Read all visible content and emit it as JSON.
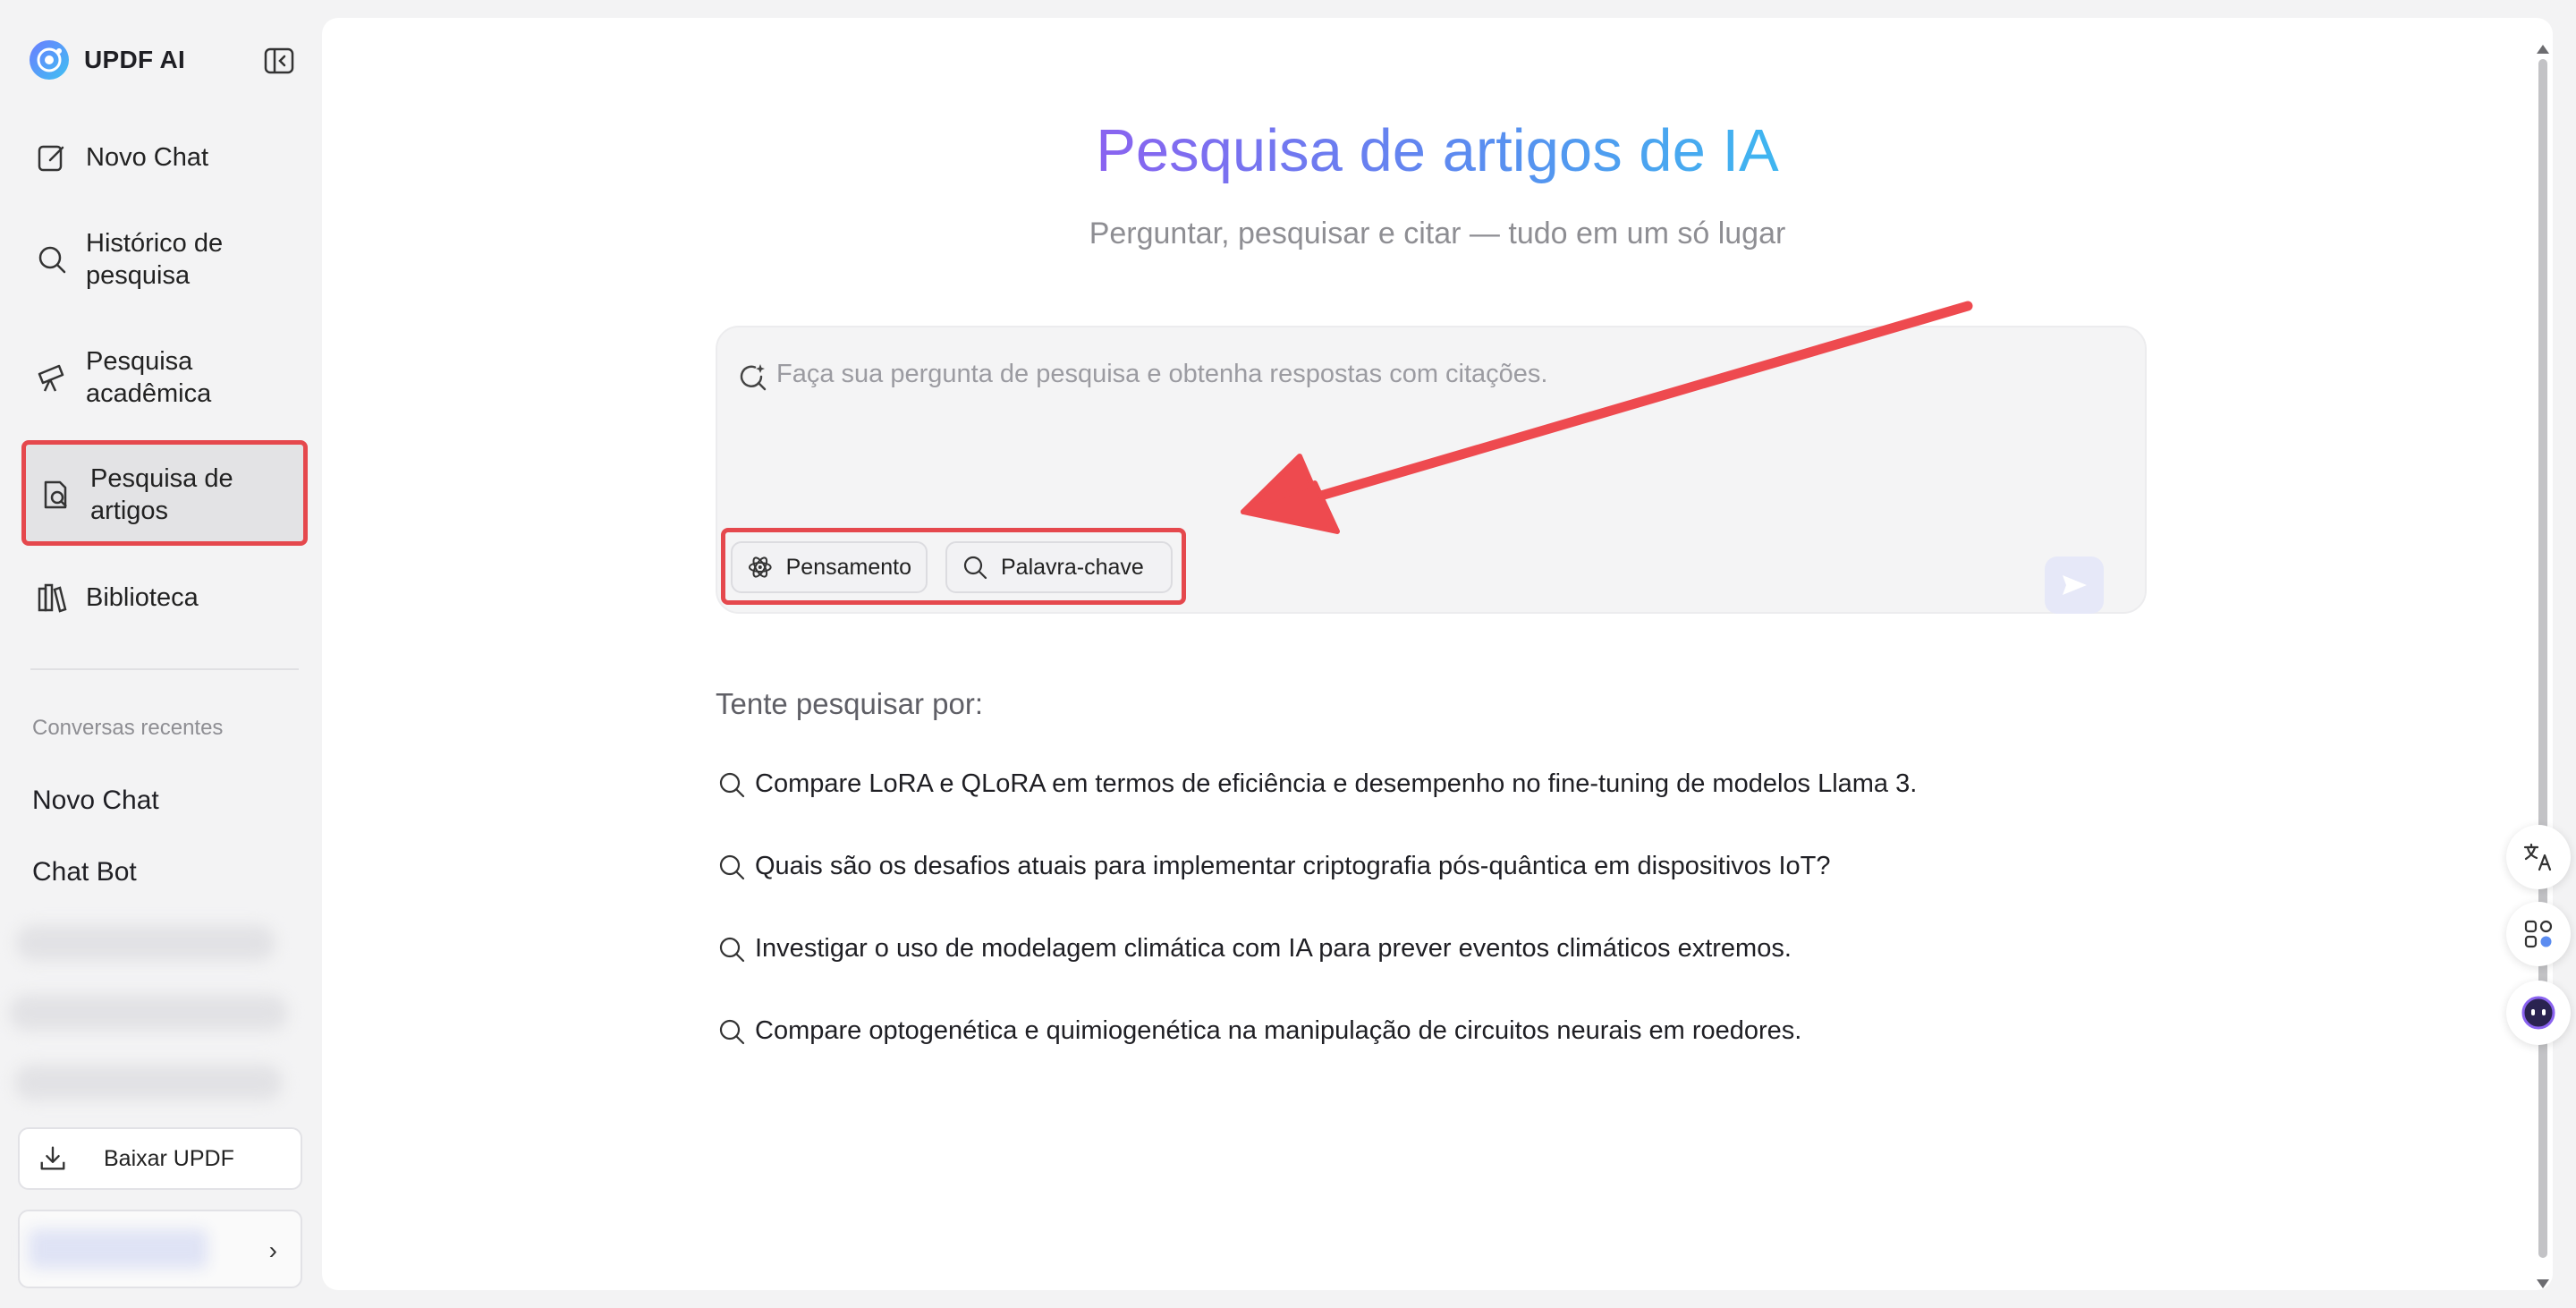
{
  "sidebar": {
    "brand": "UPDF AI",
    "nav": [
      {
        "label": "Novo Chat",
        "icon": "edit-icon"
      },
      {
        "label": "Histórico de pesquisa",
        "icon": "search-icon"
      },
      {
        "label": "Pesquisa acadêmica",
        "icon": "telescope-icon"
      },
      {
        "label": "Pesquisa de artigos",
        "icon": "document-search-icon",
        "active": true
      },
      {
        "label": "Biblioteca",
        "icon": "library-icon"
      }
    ],
    "recent_title": "Conversas recentes",
    "recent": [
      "Novo Chat",
      "Chat Bot"
    ],
    "download_label": "Baixar UPDF"
  },
  "main": {
    "title": "Pesquisa de artigos de IA",
    "subtitle": "Perguntar, pesquisar e citar — tudo em um só lugar",
    "search_placeholder": "Faça sua pergunta de pesquisa e obtenha respostas com citações.",
    "chips": [
      "Pensamento",
      "Palavra-chave"
    ],
    "try_title": "Tente pesquisar por:",
    "suggestions": [
      "Compare LoRA e QLoRA em termos de eficiência e desempenho no fine-tuning de modelos Llama 3.",
      "Quais são os desafios atuais para implementar criptografia pós-quântica em dispositivos IoT?",
      "Investigar o uso de modelagem climática com IA para prever eventos climáticos extremos.",
      "Compare optogenética e quimiogenética na manipulação de circuitos neurais em roedores."
    ]
  },
  "colors": {
    "highlight": "#e5484d",
    "title_gradient_start": "#8a63f0",
    "title_gradient_end": "#3fb6f0"
  }
}
